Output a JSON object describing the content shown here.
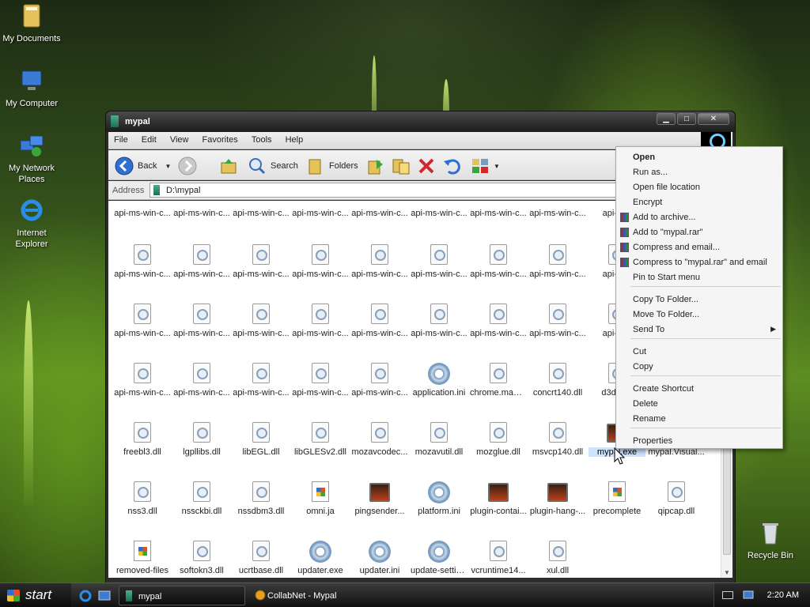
{
  "desktop": {
    "icons": [
      {
        "label": "My Documents"
      },
      {
        "label": "My Computer"
      },
      {
        "label": "My Network Places"
      },
      {
        "label": "Internet Explorer"
      },
      {
        "label": "Recycle Bin"
      }
    ]
  },
  "window": {
    "title": "mypal",
    "menu": [
      "File",
      "Edit",
      "View",
      "Favorites",
      "Tools",
      "Help"
    ],
    "toolbar": {
      "back": "Back",
      "search": "Search",
      "folders": "Folders"
    },
    "address": {
      "label": "Address",
      "value": "D:\\mypal"
    },
    "files": [
      "api-ms-win-c...",
      "api-ms-win-c...",
      "api-ms-win-c...",
      "api-ms-win-c...",
      "api-ms-win-c...",
      "api-ms-win-c...",
      "api-ms-win-c...",
      "api-ms-win-c...",
      "api-ms-",
      "api-ms-win-c...",
      "api-ms-win-c...",
      "api-ms-win-c...",
      "api-ms-win-c...",
      "api-ms-win-c...",
      "api-ms-win-c...",
      "api-ms-win-c...",
      "api-ms-win-c...",
      "api-ms-",
      "api-ms-win-c...",
      "api-ms-win-c...",
      "api-ms-win-c...",
      "api-ms-win-c...",
      "api-ms-win-c...",
      "api-ms-win-c...",
      "api-ms-win-c...",
      "api-ms-win-c...",
      "api-ms-",
      "api-ms-win-c...",
      "api-ms-win-c...",
      "api-ms-win-c...",
      "api-ms-win-c...",
      "api-ms-win-c...",
      "application.ini",
      "chrome.manif...",
      "concrt140.dll",
      "d3dcom",
      "freebl3.dll",
      "lgpllibs.dll",
      "libEGL.dll",
      "libGLESv2.dll",
      "mozavcodec...",
      "mozavutil.dll",
      "mozglue.dll",
      "msvcp140.dll",
      "mypal.exe",
      "mypal.Visual...",
      "nss3.dll",
      "nssckbi.dll",
      "nssdbm3.dll",
      "omni.ja",
      "pingsender...",
      "platform.ini",
      "plugin-contai...",
      "plugin-hang-...",
      "precomplete",
      "qipcap.dll",
      "removed-files",
      "softokn3.dll",
      "ucrtbase.dll",
      "updater.exe",
      "updater.ini",
      "update-settin...",
      "vcruntime14...",
      "xul.dll"
    ]
  },
  "context_menu": {
    "items": [
      "Open",
      "Run as...",
      "Open file location",
      "Encrypt",
      "Add to archive...",
      "Add to \"mypal.rar\"",
      "Compress and email...",
      "Compress to \"mypal.rar\" and email",
      "Pin to Start menu",
      "Copy To Folder...",
      "Move To Folder...",
      "Send To",
      "Cut",
      "Copy",
      "Create Shortcut",
      "Delete",
      "Rename",
      "Properties"
    ]
  },
  "taskbar": {
    "start": "start",
    "tasks": [
      "mypal",
      "CollabNet - Mypal"
    ],
    "clock": "2:20 AM"
  },
  "colors": {
    "selection": "#cde4ff",
    "taskbar": "#1a1a1a",
    "window_chrome": "#2d2d2d"
  }
}
